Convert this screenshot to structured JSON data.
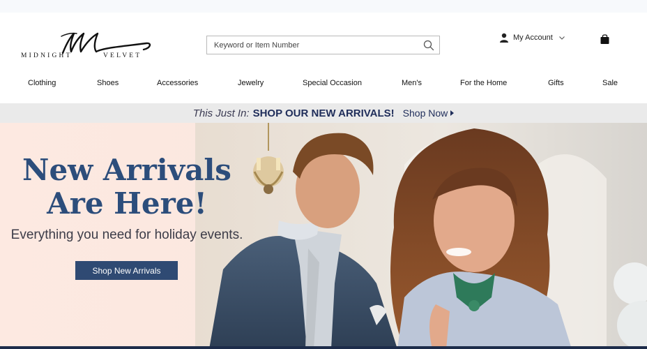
{
  "brand": {
    "logo_left_text": "MIDNIGHT",
    "logo_right_text": "VELVET",
    "logo_icon": "midnight-velvet-monogram"
  },
  "search": {
    "placeholder": "Keyword or Item Number",
    "value": "",
    "icon": "search-icon"
  },
  "account": {
    "label": "My Account",
    "icon": "user-icon"
  },
  "cart": {
    "icon": "shopping-bag-icon"
  },
  "nav": {
    "items": [
      {
        "label": "Clothing"
      },
      {
        "label": "Shoes"
      },
      {
        "label": "Accessories"
      },
      {
        "label": "Jewelry"
      },
      {
        "label": "Special Occasion"
      },
      {
        "label": "Men's"
      },
      {
        "label": "For the Home"
      },
      {
        "label": "Gifts"
      },
      {
        "label": "Sale"
      }
    ]
  },
  "promo": {
    "lead": "This Just In:",
    "headline": "SHOP OUR NEW ARRIVALS!",
    "cta": "Shop Now"
  },
  "hero": {
    "title_line1": "New Arrivals",
    "title_line2": "Are Here!",
    "subtitle": "Everything you need for holiday events.",
    "button_label": "Shop New Arrivals"
  },
  "colors": {
    "brand_navy": "#2c4d7b",
    "button_navy": "#2f4a73",
    "promo_text": "#1f2d5a",
    "hero_background": "#fbe8e0"
  }
}
